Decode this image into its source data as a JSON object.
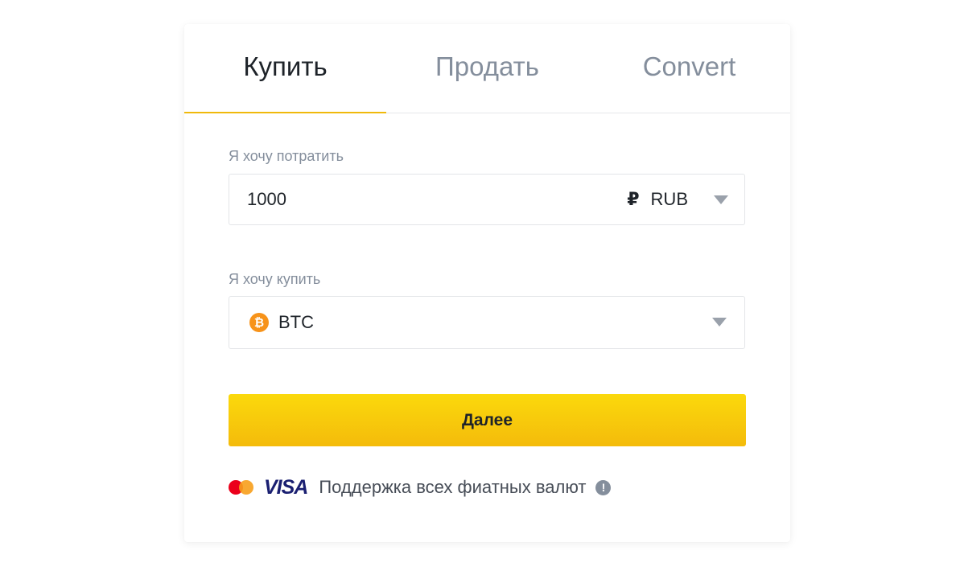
{
  "tabs": [
    {
      "label": "Купить",
      "active": true
    },
    {
      "label": "Продать",
      "active": false
    },
    {
      "label": "Convert",
      "active": false
    }
  ],
  "spend": {
    "label": "Я хочу потратить",
    "value": "1000",
    "currency_symbol": "₽",
    "currency_code": "RUB",
    "caret_icon": "caret-down-icon"
  },
  "buy": {
    "label": "Я хочу купить",
    "coin_icon": "bitcoin-icon",
    "coin_icon_glyph": "₿",
    "coin_code": "BTC",
    "caret_icon": "caret-down-icon"
  },
  "next_button": {
    "label": "Далее"
  },
  "payment_support": {
    "icons": [
      "mastercard-icon",
      "visa-logo"
    ],
    "visa_text": "VISA",
    "text": "Поддержка всех фиатных валют",
    "info_icon": "info-icon",
    "info_glyph": "!"
  },
  "colors": {
    "accent": "#f0b90b",
    "button_top": "#fbd90c",
    "button_bottom": "#f4bb0b",
    "tab_active": "#1e2329",
    "tab_inactive": "#848e9c",
    "btc_orange": "#f7931a",
    "visa_blue": "#1a1f71"
  }
}
